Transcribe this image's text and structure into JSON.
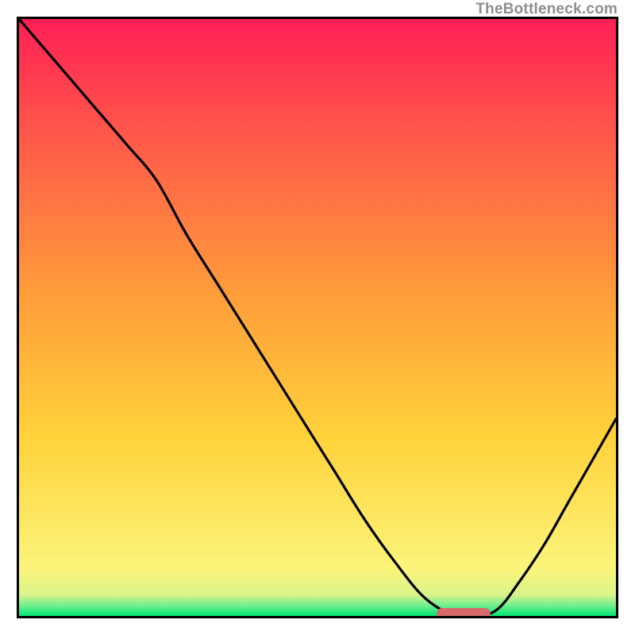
{
  "attribution": "TheBottleneck.com",
  "chart_data": {
    "type": "line",
    "title": "",
    "xlabel": "",
    "ylabel": "",
    "xlim": [
      0,
      100
    ],
    "ylim": [
      0,
      100
    ],
    "series": [
      {
        "name": "bottleneck-curve",
        "x": [
          0,
          6,
          12,
          18,
          23,
          28,
          33,
          38,
          43,
          48,
          53,
          58,
          63,
          68,
          73,
          76,
          80,
          84,
          88,
          92,
          96,
          100
        ],
        "y": [
          100,
          93,
          86,
          79,
          73,
          64,
          56,
          48,
          40,
          32,
          24,
          16,
          9,
          3,
          0,
          0,
          1,
          6,
          12,
          19,
          26,
          33
        ]
      }
    ],
    "marker": {
      "name": "optimal-range",
      "x_start": 70,
      "x_end": 79,
      "y": 0,
      "color": "#d46a6a"
    },
    "background_gradient": {
      "stops": [
        {
          "pos": 0.0,
          "color": "#00e676"
        },
        {
          "pos": 0.02,
          "color": "#7ff08f"
        },
        {
          "pos": 0.035,
          "color": "#d9f48a"
        },
        {
          "pos": 0.08,
          "color": "#fcf47a"
        },
        {
          "pos": 0.3,
          "color": "#ffd23a"
        },
        {
          "pos": 0.55,
          "color": "#ff9a3a"
        },
        {
          "pos": 0.8,
          "color": "#ff5a4a"
        },
        {
          "pos": 1.0,
          "color": "#ff1f55"
        }
      ]
    }
  }
}
